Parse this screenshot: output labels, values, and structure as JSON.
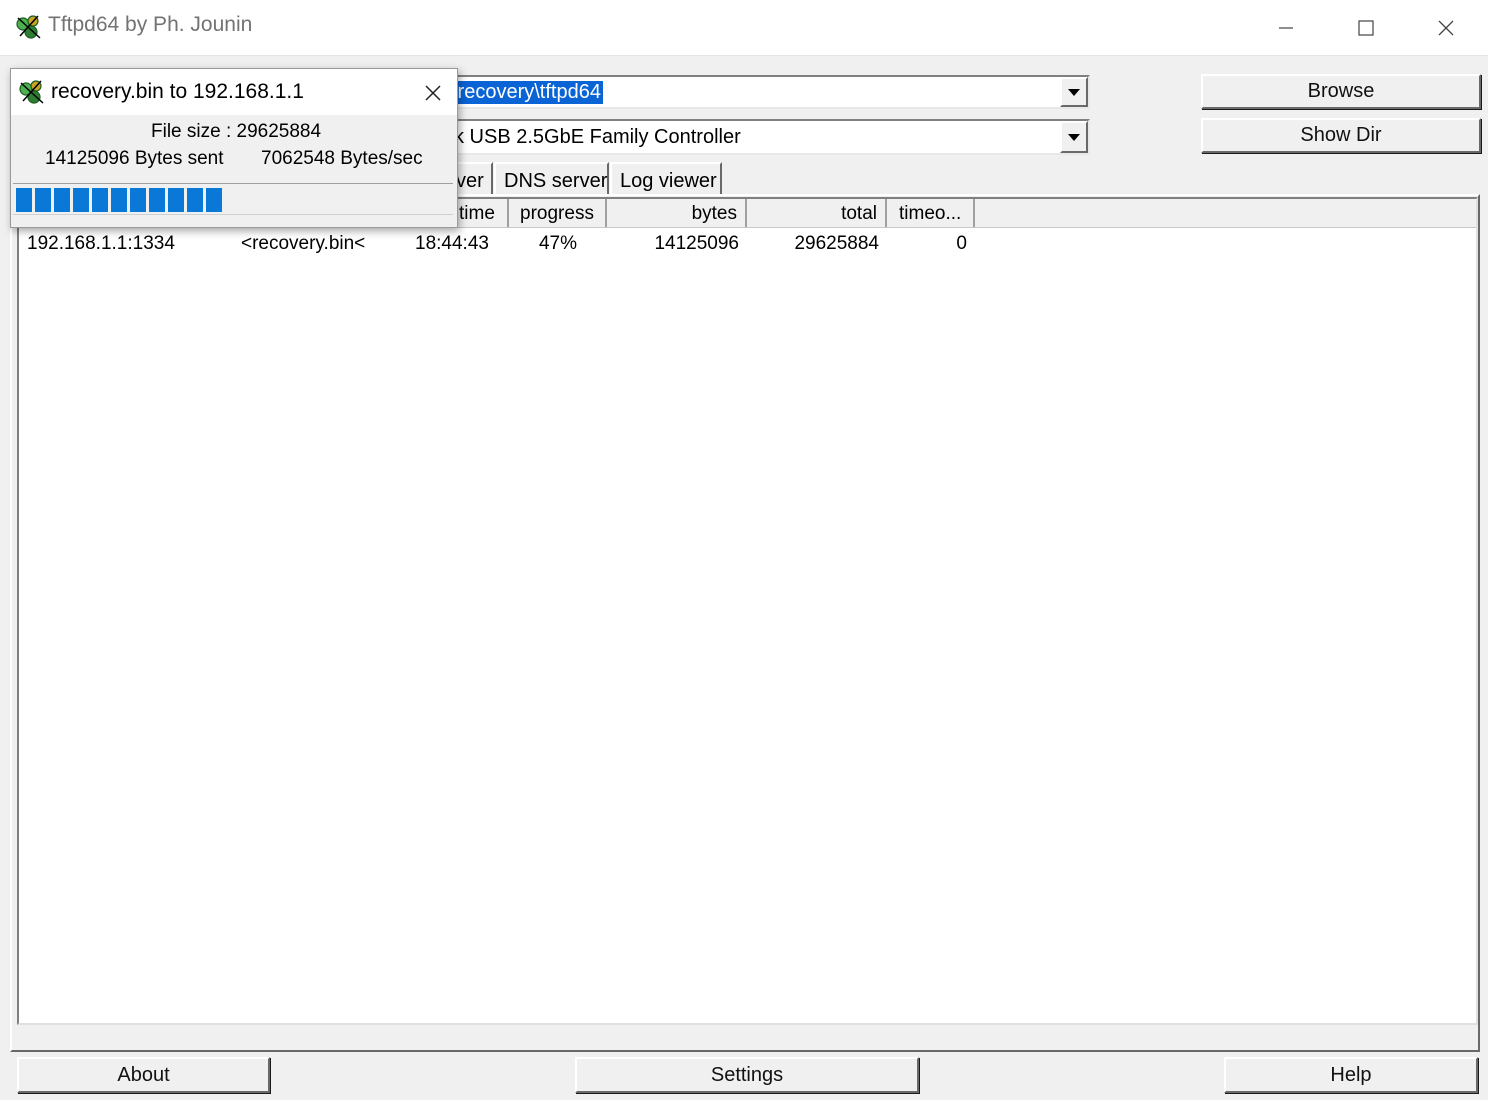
{
  "window": {
    "title": "Tftpd64 by Ph. Jounin"
  },
  "toolbar": {
    "current_directory": "\\recovery\\tftpd64",
    "server_interface": "k USB 2.5GbE Family Controller",
    "browse_label": "Browse",
    "show_dir_label": "Show Dir"
  },
  "tabs": [
    {
      "label": "ver"
    },
    {
      "label": "DNS server"
    },
    {
      "label": "Log viewer"
    }
  ],
  "table": {
    "columns": [
      "time",
      "progress",
      "bytes",
      "total",
      "timeo..."
    ],
    "rows": [
      {
        "peer": "192.168.1.1:1334",
        "file": "<recovery.bin<",
        "time": "18:44:43",
        "progress": "47%",
        "bytes": "14125096",
        "total": "29625884",
        "timeout": "0"
      }
    ]
  },
  "footer": {
    "about_label": "About",
    "settings_label": "Settings",
    "help_label": "Help"
  },
  "transfer_popup": {
    "title": "recovery.bin to 192.168.1.1",
    "file_size": "File size : 29625884",
    "bytes_sent": "14125096 Bytes sent",
    "rate": "7062548 Bytes/sec",
    "progress_fraction": 0.47,
    "progress_color": "#0a78d7"
  }
}
